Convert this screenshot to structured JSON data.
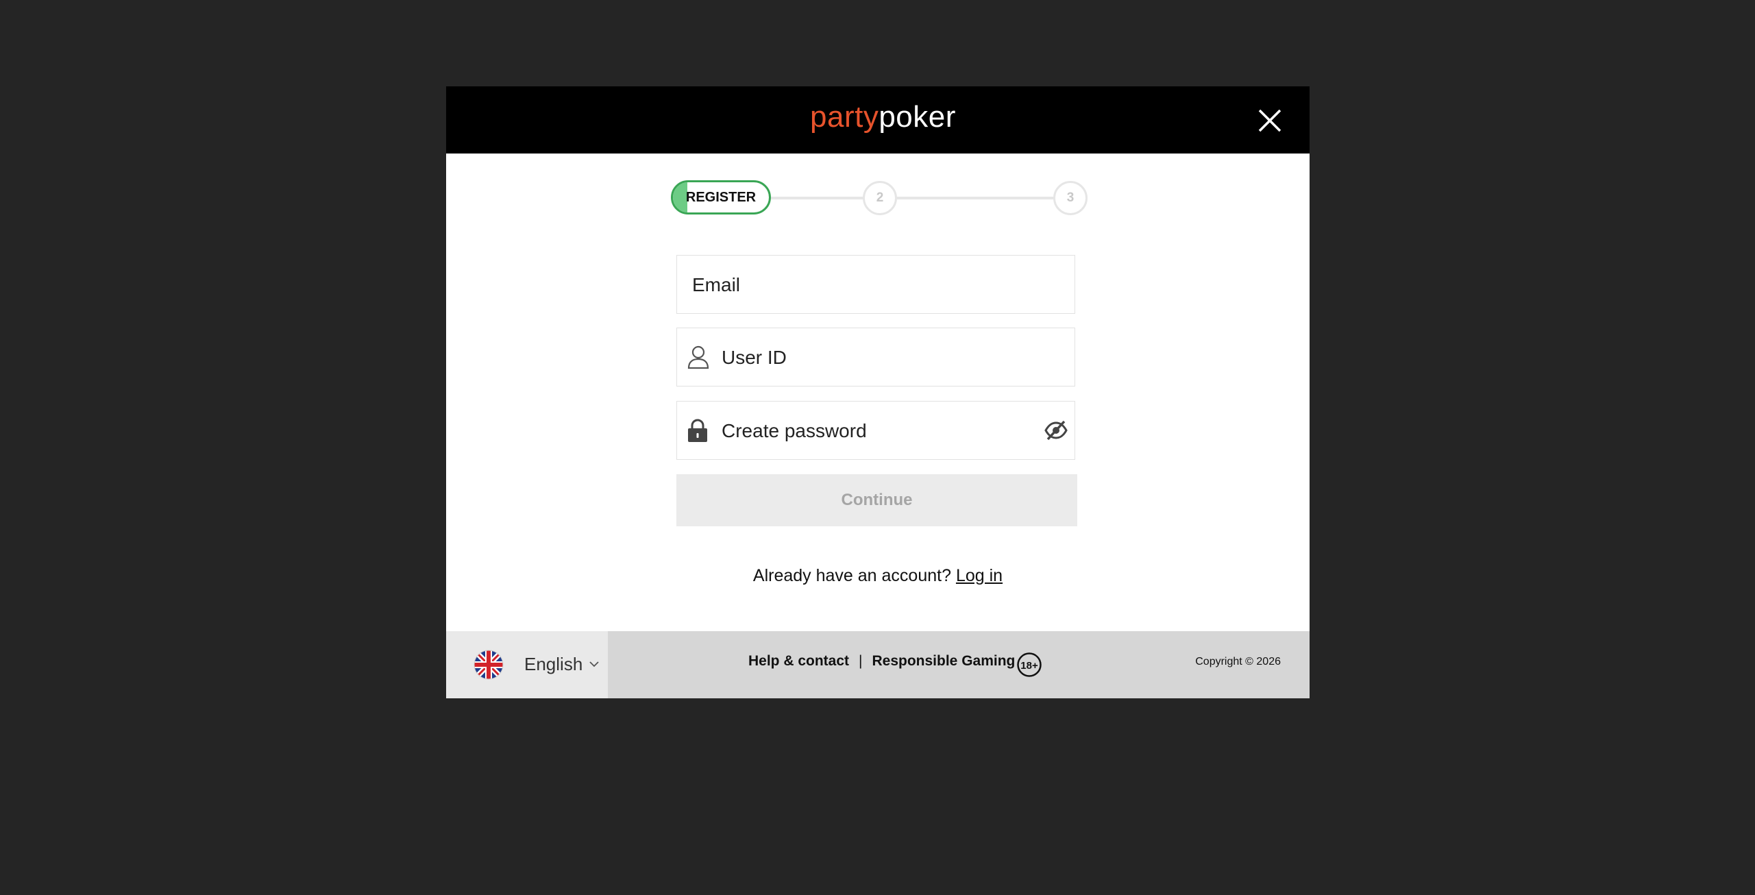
{
  "header": {
    "logo_party": "party",
    "logo_poker": "poker",
    "close_icon": "close-icon"
  },
  "progress": {
    "active_step_label": "REGISTER",
    "active_step_progress": 0.15,
    "step2": "2",
    "step3": "3",
    "colors": {
      "active": "#3aa655",
      "active_fill": "#6dcc85",
      "inactive": "#e6e6e6"
    }
  },
  "form": {
    "email_placeholder": "Email",
    "userid_placeholder": "User ID",
    "password_placeholder": "Create password",
    "continue_label": "Continue",
    "icons": [
      "user-icon",
      "lock-icon",
      "eye-slash-icon"
    ]
  },
  "login": {
    "prompt": "Already have an account?",
    "link": "Log in"
  },
  "footer": {
    "language": "English",
    "help_label": "Help & contact",
    "separator": "|",
    "responsible_label": "Responsible Gaming",
    "age_badge": "18+",
    "copyright": "Copyright © 2026",
    "icons": [
      "uk-flag-icon",
      "chevron-down-icon"
    ]
  },
  "colors": {
    "backdrop": "#252525",
    "brand_orange": "#e7532c",
    "header_bg": "#000000",
    "footer_bg": "#d6d6d6"
  }
}
